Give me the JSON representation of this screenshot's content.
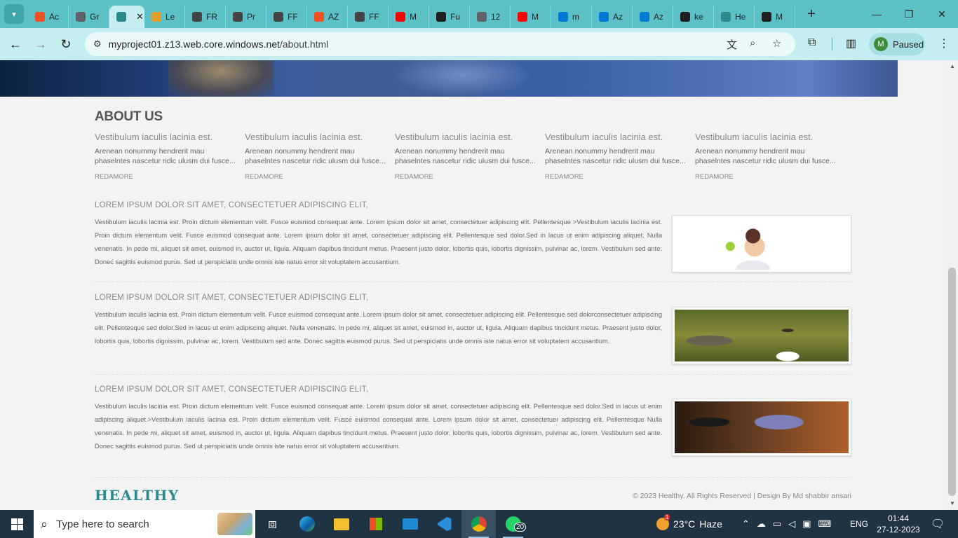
{
  "browser": {
    "tabs": [
      {
        "label": "Ac",
        "icon": "microsoft-icon",
        "color": "#f25022"
      },
      {
        "label": "Gr",
        "icon": "globe-icon",
        "color": "#5f6368"
      },
      {
        "label": "",
        "icon": "healthy-tree-icon",
        "color": "#2c8a8e",
        "active": true
      },
      {
        "label": "Le",
        "icon": "learn-icon",
        "color": "#e0a030"
      },
      {
        "label": "FR",
        "icon": "document-icon",
        "color": "#444"
      },
      {
        "label": "Pr",
        "icon": "document-icon",
        "color": "#444"
      },
      {
        "label": "FF",
        "icon": "document-icon",
        "color": "#444"
      },
      {
        "label": "AZ",
        "icon": "microsoft-icon",
        "color": "#f25022"
      },
      {
        "label": "FF",
        "icon": "document-icon",
        "color": "#444"
      },
      {
        "label": "M",
        "icon": "youtube-icon",
        "color": "#ff0000"
      },
      {
        "label": "Fu",
        "icon": "github-icon",
        "color": "#1f1f1f"
      },
      {
        "label": "12",
        "icon": "globe-icon",
        "color": "#5f6368"
      },
      {
        "label": "M",
        "icon": "youtube-icon",
        "color": "#ff0000"
      },
      {
        "label": "m",
        "icon": "azure-icon",
        "color": "#0078d4"
      },
      {
        "label": "Az",
        "icon": "azure-devops-icon",
        "color": "#0078d4"
      },
      {
        "label": "Az",
        "icon": "azure-devops-icon",
        "color": "#0078d4"
      },
      {
        "label": "ke",
        "icon": "github-icon",
        "color": "#1f1f1f"
      },
      {
        "label": "He",
        "icon": "healthy-tree-icon",
        "color": "#2c8a8e"
      },
      {
        "label": "M",
        "icon": "github-icon",
        "color": "#1f1f1f"
      }
    ],
    "url_host": "myproject01.z13.web.core.windows.net",
    "url_path": "/about.html",
    "profile_initial": "M",
    "profile_status": "Paused"
  },
  "page": {
    "about_title": "ABOUT US",
    "columns": [
      {
        "heading": "Vestibulum iaculis lacinia est.",
        "text": "Arenean nonummy hendrerit mau phaselntes nascetur ridic ulusm dui fusce...",
        "more": "REDAMORE"
      },
      {
        "heading": "Vestibulum iaculis lacinia est.",
        "text": "Arenean nonummy hendrerit mau phaselntes nascetur ridic ulusm dui fusce...",
        "more": "REDAMORE"
      },
      {
        "heading": "Vestibulum iaculis lacinia est.",
        "text": "Arenean nonummy hendrerit mau phaselntes nascetur ridic ulusm dui fusce...",
        "more": "REDAMORE"
      },
      {
        "heading": "Vestibulum iaculis lacinia est.",
        "text": "Arenean nonummy hendrerit mau phaselntes nascetur ridic ulusm dui fusce...",
        "more": "REDAMORE"
      },
      {
        "heading": "Vestibulum iaculis lacinia est.",
        "text": "Arenean nonummy hendrerit mau phaselntes nascetur ridic ulusm dui fusce...",
        "more": "REDAMORE"
      }
    ],
    "sections": [
      {
        "title": "LOREM IPSUM DOLOR SIT AMET, CONSECTETUER ADIPISCING ELIT,",
        "body": "Vestibulum iaculis lacinia est. Proin dictum elementum velit. Fusce euismod consequat ante. Lorem ipsum dolor sit amet, consectetuer adipiscing elit. Pellentesque >Vestibulum iaculis lacinia est. Proin dictum elementum velit. Fusce euismod consequat ante. Lorem ipsum dolor sit amet, consectetuer adipiscing elit. Pellentesque sed dolor.Sed in lacus ut enim adipiscing aliquet. Nulla venenatis. In pede mi, aliquet sit amet, euismod in, auctor ut, ligula. Aliquam dapibus tincidunt metus. Praesent justo dolor, lobortis quis, lobortis dignissim, pulvinar ac, lorem. Vestibulum sed ante. Donec sagittis euismod purus. Sed ut perspiciatis unde omnis iste natus error sit voluptatem accusantium.",
        "image": "woman-with-apple-photo"
      },
      {
        "title": "LOREM IPSUM DOLOR SIT AMET, CONSECTETUER ADIPISCING ELIT,",
        "body": "Vestibulum iaculis lacinia est. Proin dictum elementum velit. Fusce euismod consequat ante. Lorem ipsum dolor sit amet, consectetuer adipiscing elit. Pellentesque sed dolorconsectetuer adipiscing elit. Pellentesque sed dolor.Sed in lacus ut enim adipiscing aliquet. Nulla venenatis. In pede mi, aliquet sit amet, euismod in, auctor ut, ligula. Aliquam dapibus tincidunt metus. Praesent justo dolor, lobortis quis, lobortis dignissim, pulvinar ac, lorem. Vestibulum sed ante. Donec sagittis euismod purus. Sed ut perspiciatis unde omnis iste natus error sit voluptatem accusantium.",
        "image": "woman-in-field-photo"
      },
      {
        "title": "LOREM IPSUM DOLOR SIT AMET, CONSECTETUER ADIPISCING ELIT,",
        "body": "Vestibulum iaculis lacinia est. Proin dictum elementum velit. Fusce euismod consequat ante. Lorem ipsum dolor sit amet, consectetuer adipiscing elit. Pellentesque sed dolor.Sed in lacus ut enim adipiscing aliquet.>Vestibulum iaculis lacinia est. Proin dictum elementum velit. Fusce euismod consequat ante. Lorem ipsum dolor sit amet, consectetuer adipiscing elit. Pellentesque Nulla venenatis. In pede mi, aliquet sit amet, euismod in, auctor ut, ligula. Aliquam dapibus tincidunt metus. Praesent justo dolor, lobortis quis, lobortis dignissim, pulvinar ac, lorem. Vestibulum sed ante. Donec sagittis euismod purus. Sed ut perspiciatis unde omnis iste natus error sit voluptatem accusantium.",
        "image": "dentist-photo"
      }
    ],
    "footer_logo": "HEALTHY",
    "copyright": "© 2023 Healthy. All Rights Reserved | Design By Md shabbir ansari"
  },
  "taskbar": {
    "search_placeholder": "Type here to search",
    "weather_temp": "23°C",
    "weather_desc": "Haze",
    "weather_badge": "1",
    "language": "ENG",
    "time": "01:44",
    "date": "27-12-2023",
    "whatsapp_badge": "20"
  }
}
